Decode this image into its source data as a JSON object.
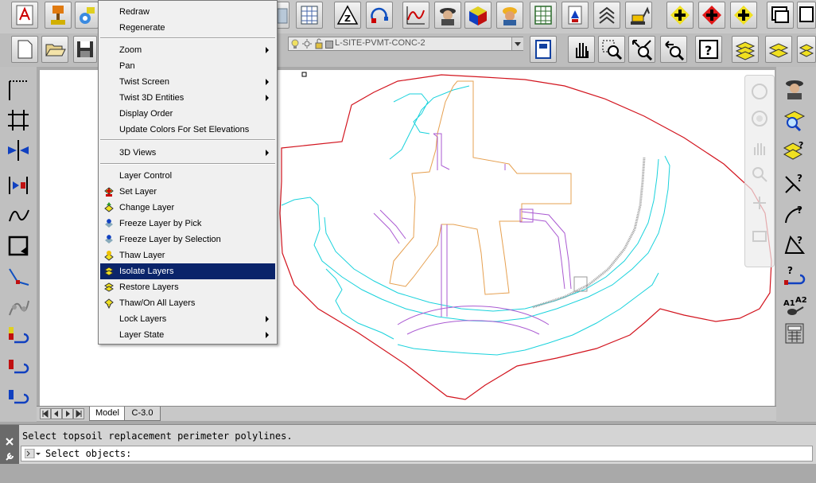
{
  "menu": {
    "items": [
      {
        "label": "Redraw",
        "submenu": false
      },
      {
        "label": "Regenerate",
        "submenu": false
      },
      {
        "label": "Zoom",
        "submenu": true
      },
      {
        "label": "Pan",
        "submenu": false
      },
      {
        "label": "Twist Screen",
        "submenu": true
      },
      {
        "label": "Twist 3D Entities",
        "submenu": true
      },
      {
        "label": "Display Order",
        "submenu": false
      },
      {
        "label": "Update Colors For Set Elevations",
        "submenu": false
      },
      {
        "label": "3D Views",
        "submenu": true
      },
      {
        "label": "Layer Control",
        "submenu": false
      },
      {
        "label": "Set Layer",
        "submenu": false,
        "icon": "set-layer-icon"
      },
      {
        "label": "Change Layer",
        "submenu": false,
        "icon": "change-layer-icon"
      },
      {
        "label": "Freeze Layer by Pick",
        "submenu": false,
        "icon": "freeze-layer-icon"
      },
      {
        "label": "Freeze Layer by Selection",
        "submenu": false,
        "icon": "freeze-selection-icon"
      },
      {
        "label": "Thaw Layer",
        "submenu": false,
        "icon": "thaw-layer-icon"
      },
      {
        "label": "Isolate Layers",
        "submenu": false,
        "icon": "isolate-layers-icon",
        "selected": true
      },
      {
        "label": "Restore Layers",
        "submenu": false,
        "icon": "restore-layers-icon"
      },
      {
        "label": "Thaw/On All Layers",
        "submenu": false,
        "icon": "thaw-all-icon"
      },
      {
        "label": "Lock Layers",
        "submenu": true
      },
      {
        "label": "Layer State",
        "submenu": true
      }
    ]
  },
  "layer_control": {
    "current_layer": "L-SITE-PVMT-CONC-2"
  },
  "tabs": [
    {
      "label": "Model",
      "active": true
    },
    {
      "label": "C-3.0",
      "active": false
    }
  ],
  "command": {
    "history": "Select topsoil replacement perimeter polylines.",
    "prompt": "Select objects:"
  },
  "colors": {
    "boundary": "#d2141e",
    "curb": "#19d2dc",
    "building": "#e6a050",
    "walk": "#aa5ad2",
    "selection": "#0a246a"
  }
}
